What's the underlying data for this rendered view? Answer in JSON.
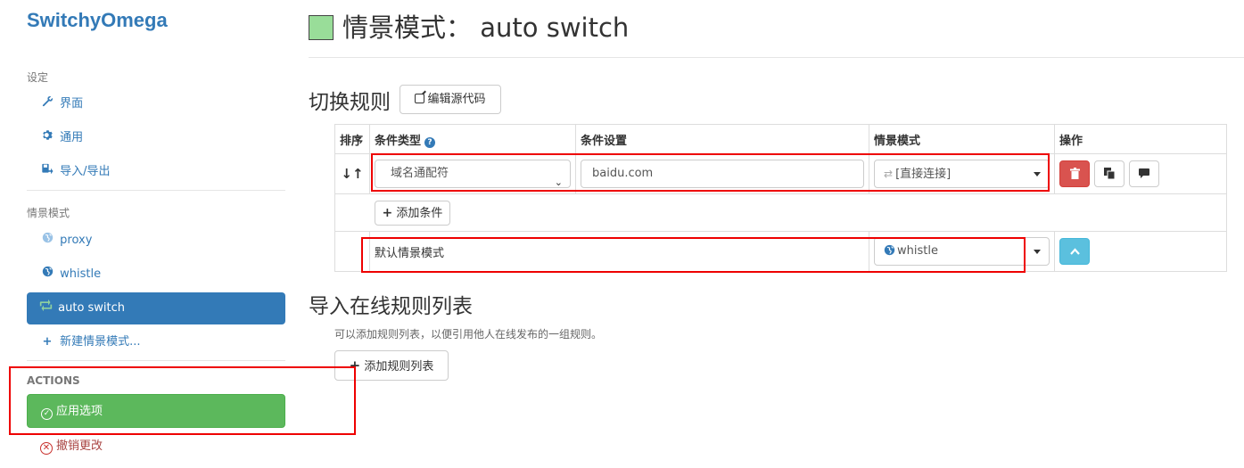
{
  "app": {
    "brand": "SwitchyOmega"
  },
  "sidebar": {
    "settings_header": "设定",
    "settings_items": [
      {
        "label": "界面",
        "icon": "wrench-icon"
      },
      {
        "label": "通用",
        "icon": "gear-icon"
      },
      {
        "label": "导入/导出",
        "icon": "import-export-icon"
      }
    ],
    "profiles_header": "情景模式",
    "profiles": [
      {
        "label": "proxy",
        "icon": "globe-icon"
      },
      {
        "label": "whistle",
        "icon": "globe-icon"
      },
      {
        "label": "auto switch",
        "icon": "retweet-icon",
        "active": true
      }
    ],
    "new_profile": "新建情景模式...",
    "actions_header": "ACTIONS",
    "apply_label": "应用选项",
    "discard_label": "撤销更改"
  },
  "header": {
    "title_prefix": "情景模式：",
    "profile_name": "auto switch",
    "profile_color": "#99dd99"
  },
  "rules": {
    "section_title": "切换规则",
    "edit_source_label": "编辑源代码",
    "columns": [
      "排序",
      "条件类型",
      "条件设置",
      "情景模式",
      "操作"
    ],
    "rows": [
      {
        "condition_type": "域名通配符",
        "condition": "baidu.com",
        "profile": "[直接连接]"
      }
    ],
    "add_condition_label": "添加条件",
    "default_label": "默认情景模式",
    "default_profile": "whistle"
  },
  "import": {
    "section_title": "导入在线规则列表",
    "help_text": "可以添加规则列表，以便引用他人在线发布的一组规则。",
    "add_list_label": "添加规则列表"
  },
  "colors": {
    "primary": "#337ab7",
    "success": "#5cb85c",
    "danger": "#d9534f",
    "info": "#5bc0de",
    "highlight": "#ee0000"
  }
}
